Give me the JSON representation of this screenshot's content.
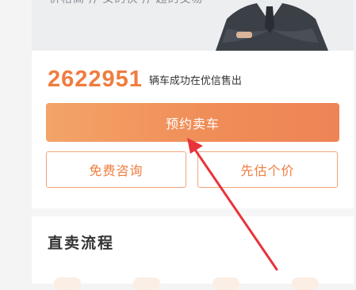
{
  "banner": {
    "slogan": "价格高 // 女的快 // 超的交易",
    "person_icon": "person-in-suit-icon"
  },
  "sold": {
    "count": "2622951",
    "suffix": "辆车成功在优信售出"
  },
  "buttons": {
    "primary_label": "预约卖车",
    "consult_label": "免费咨询",
    "estimate_label": "先估个价"
  },
  "section": {
    "title": "直卖流程"
  },
  "colors": {
    "accent": "#f07c3e",
    "button_gradient_start": "#f3a468",
    "button_gradient_end": "#ee8456",
    "annotation_arrow": "#e8333a"
  },
  "annotation": {
    "icon": "red-arrow-pointer-icon"
  }
}
